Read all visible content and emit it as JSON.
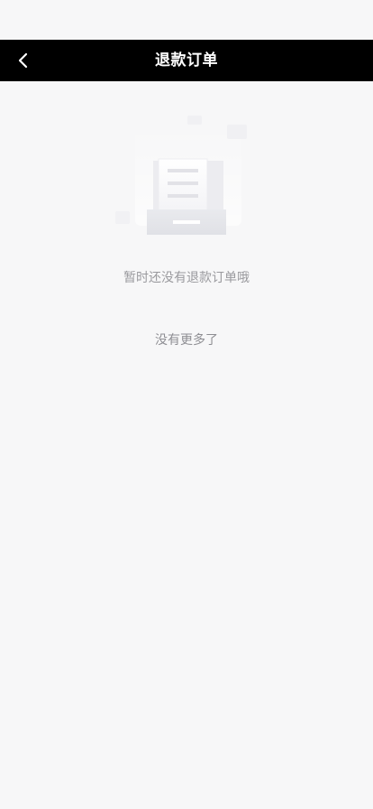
{
  "header": {
    "title": "退款订单",
    "back_icon": "chevron-left-icon"
  },
  "empty_state": {
    "illustration": "empty-document-tray-icon",
    "message": "暂时还没有退款订单哦"
  },
  "list_footer": {
    "text": "没有更多了"
  },
  "colors": {
    "nav_background": "#000000",
    "page_background": "#f7f7f8",
    "secondary_text": "#9a9a9e"
  }
}
